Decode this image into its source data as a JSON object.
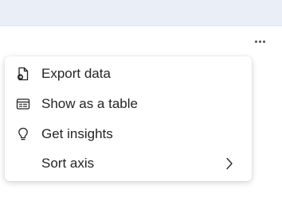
{
  "colors": {
    "topbar": "#e9eef7",
    "menu_text": "#252423",
    "icon": "#252423"
  },
  "header": {
    "more_options_icon": "more-horizontal-icon"
  },
  "context_menu": {
    "items": [
      {
        "label": "Export data",
        "icon": "export-data-icon",
        "has_submenu": false
      },
      {
        "label": "Show as a table",
        "icon": "table-view-icon",
        "has_submenu": false
      },
      {
        "label": "Get insights",
        "icon": "lightbulb-icon",
        "has_submenu": false
      },
      {
        "label": "Sort axis",
        "icon": "",
        "has_submenu": true
      }
    ]
  }
}
